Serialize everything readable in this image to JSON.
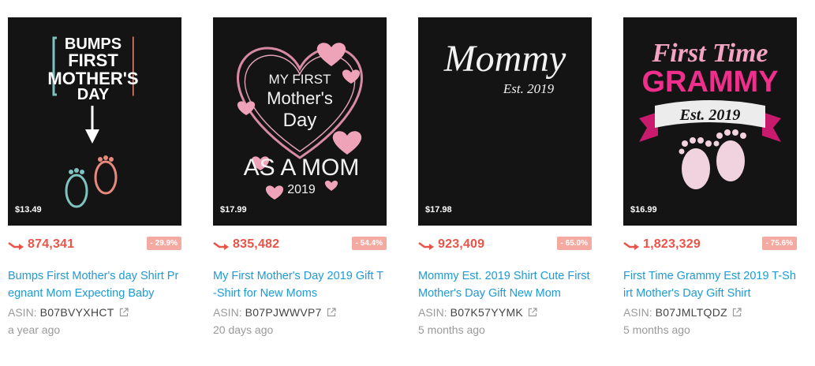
{
  "labels": {
    "asin_prefix": "ASIN:"
  },
  "colors": {
    "rank": "#ea5448",
    "badge": "#f4a9a1",
    "title_link": "#1e9ad6",
    "image_bg": "#141414"
  },
  "products": [
    {
      "price": "$13.49",
      "rank": "874,341",
      "change": "- 29.9%",
      "title": "Bumps First Mother's day Shirt Pregnant Mom Expecting Baby",
      "asin": "B07BVYXHCT",
      "age": "a year ago",
      "art": {
        "l1": "BUMPS",
        "l2": "FIRST",
        "l3": "MOTHER'S",
        "l4": "DAY"
      }
    },
    {
      "price": "$17.99",
      "rank": "835,482",
      "change": "- 54.4%",
      "title": "My First Mother's Day 2019 Gift T-Shirt for New Moms",
      "asin": "B07PJWWVP7",
      "age": "20 days ago",
      "art": {
        "l1": "MY FIRST",
        "l2": "Mother's",
        "l3": "Day",
        "l4": "AS A MOM",
        "l5": "2019"
      }
    },
    {
      "price": "$17.98",
      "rank": "923,409",
      "change": "- 65.0%",
      "title": "Mommy Est. 2019 Shirt Cute First Mother's Day Gift New Mom",
      "asin": "B07K57YYMK",
      "age": "5 months ago",
      "art": {
        "l1": "Mommy",
        "l2": "Est. 2019"
      }
    },
    {
      "price": "$16.99",
      "rank": "1,823,329",
      "change": "- 75.6%",
      "title": "First Time Grammy Est 2019 T-Shirt Mother's Day Gift Shirt",
      "asin": "B07JMLTQDZ",
      "age": "5 months ago",
      "art": {
        "l1": "First Time",
        "l2": "GRAMMY",
        "l3": "Est. 2019"
      }
    }
  ]
}
